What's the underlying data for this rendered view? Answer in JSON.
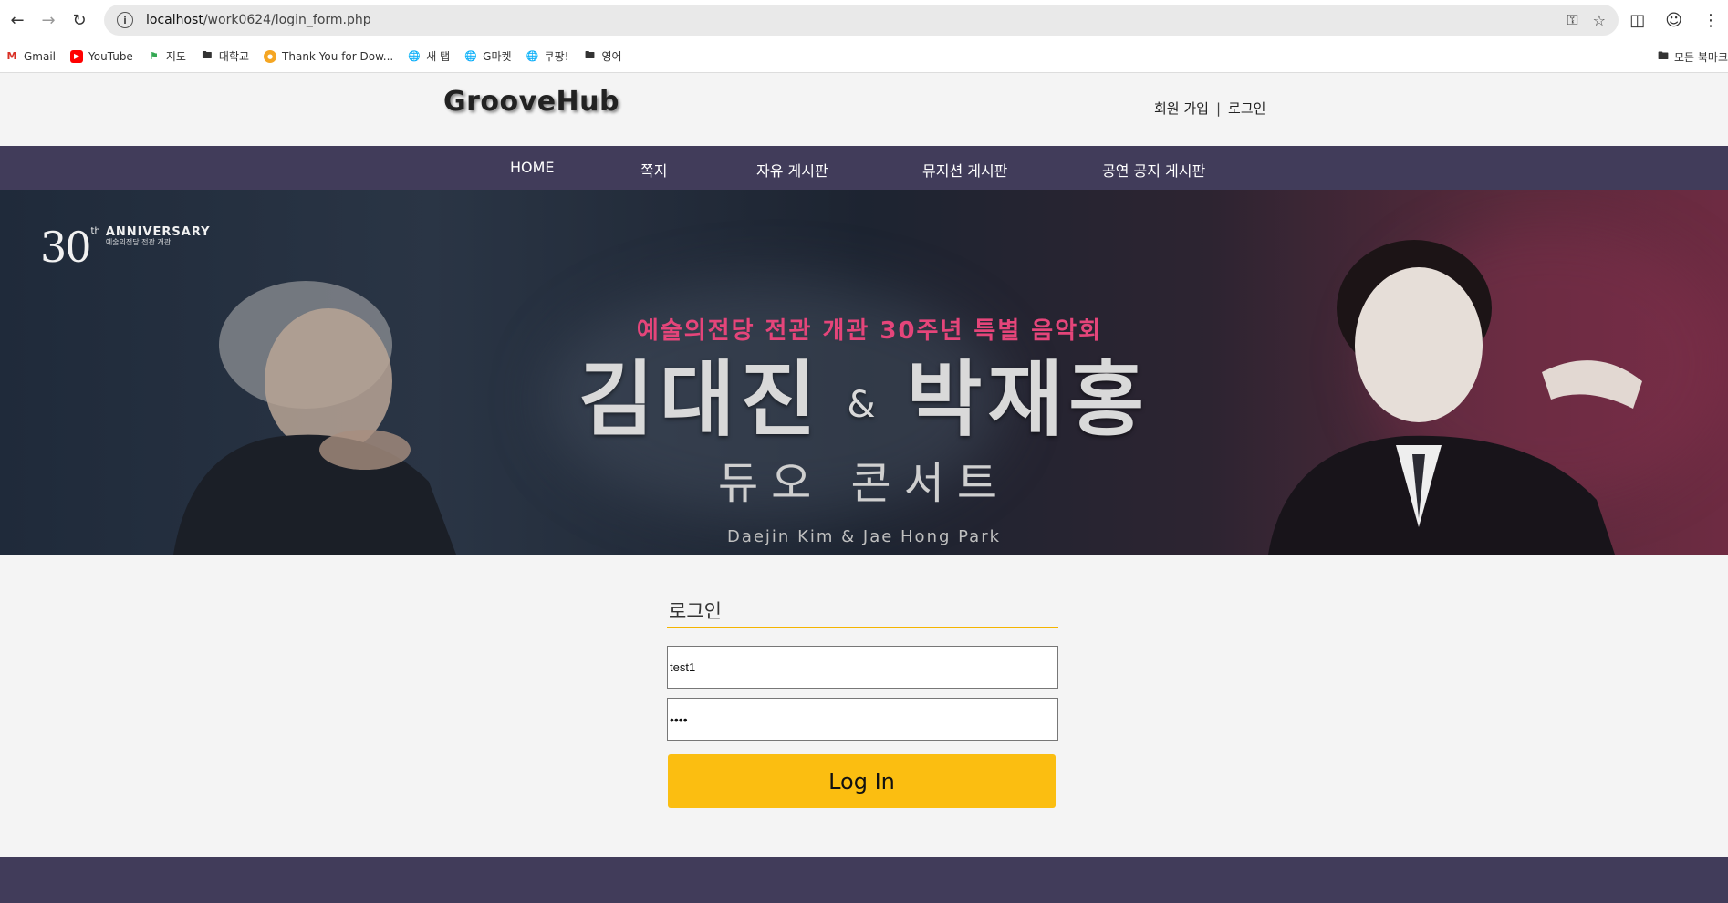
{
  "browser": {
    "url_prefix": "localhost",
    "url_path": "/work0624/login_form.php",
    "bookmarks": [
      {
        "label": "Gmail",
        "icon": "gmail-icon"
      },
      {
        "label": "YouTube",
        "icon": "youtube-icon"
      },
      {
        "label": "지도",
        "icon": "maps-icon"
      },
      {
        "label": "대학교",
        "icon": "folder-icon"
      },
      {
        "label": "Thank You for Dow...",
        "icon": "site-icon"
      },
      {
        "label": "새 탭",
        "icon": "globe-icon"
      },
      {
        "label": "G마켓",
        "icon": "globe-icon"
      },
      {
        "label": "쿠팡!",
        "icon": "globe-icon"
      },
      {
        "label": "영어",
        "icon": "folder-icon"
      }
    ],
    "bookmarks_all": "모든 북마크"
  },
  "site": {
    "logo": "GrooveHub",
    "auth": {
      "signup": "회원 가입",
      "separator": "|",
      "login": "로그인"
    },
    "nav": [
      "HOME",
      "쪽지",
      "자유 게시판",
      "뮤지션 게시판",
      "공연 공지 게시판"
    ]
  },
  "banner": {
    "anniversary_num": "30",
    "anniversary_sup": "th",
    "anniversary_text": "ANNIVERSARY",
    "anniversary_sub": "예술의전당 전관 개관",
    "subtitle": "예술의전당 전관 개관 30주년 특별 음악회",
    "performer1": "김대진",
    "amp": "&",
    "performer2": "박재홍",
    "concert": "듀오 콘서트",
    "names": "Daejin Kim & Jae Hong Park"
  },
  "login": {
    "title": "로그인",
    "id_value": "test1",
    "password_value": "••••",
    "button": "Log In"
  },
  "colors": {
    "nav_bg": "#413c5a",
    "accent": "#fbbe11",
    "subtitle_pink": "#e5457a"
  }
}
